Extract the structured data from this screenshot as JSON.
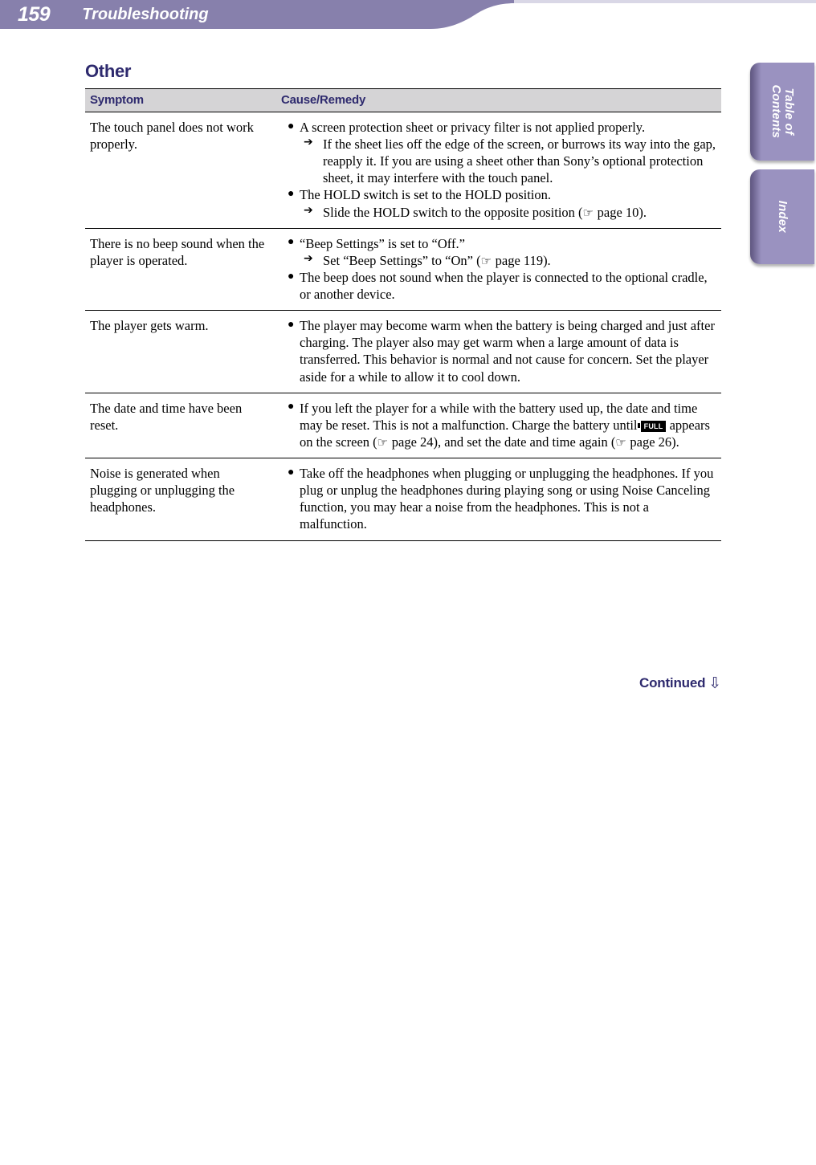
{
  "header": {
    "page_number": "159",
    "chapter_title": "Troubleshooting",
    "band_color": "#8780ac",
    "thin_rule_color": "#d9d7e6"
  },
  "side_tabs": [
    {
      "name": "table-of-contents",
      "line1": "Table of",
      "line2": "Contents"
    },
    {
      "name": "index",
      "line1": "Index",
      "line2": ""
    }
  ],
  "section": {
    "title": "Other",
    "title_color": "#2e2a6e"
  },
  "table": {
    "header_bg": "#d5d4d6",
    "columns": [
      "Symptom",
      "Cause/Remedy"
    ],
    "rows": [
      {
        "symptom": "The touch panel does not work properly.",
        "bullets": [
          {
            "text": "A screen protection sheet or privacy filter is not applied properly.",
            "arrows": [
              "If the sheet lies off the edge of the screen, or burrows its way into the gap, reapply it. If you are using a sheet other than Sony’s optional protection sheet, it may interfere with the touch panel."
            ]
          },
          {
            "text": "The HOLD switch is set to the HOLD position.",
            "arrows_rich": [
              {
                "pre": "Slide the HOLD switch to the opposite position (",
                "icon": "hand-pointing-icon",
                "mid": " page 10).",
                "post": ""
              }
            ]
          }
        ]
      },
      {
        "symptom": "There is no beep sound when the player is operated.",
        "bullets": [
          {
            "text": "“Beep Settings” is set to “Off.”",
            "arrows_rich": [
              {
                "pre": "Set “Beep Settings” to “On” (",
                "icon": "hand-pointing-icon",
                "mid": " page 119).",
                "post": ""
              }
            ]
          },
          {
            "text": "The beep does not sound when the player is connected to the optional cradle, or another device."
          }
        ]
      },
      {
        "symptom": "The player gets warm.",
        "bullets": [
          {
            "text": "The player may become warm when the battery is being charged and just after charging. The player also may get warm when a large amount of data is transferred. This behavior is normal and not cause for concern. Set the player aside for a while to allow it to cool down."
          }
        ]
      },
      {
        "symptom": "The date and time have been reset.",
        "bullets": [
          {
            "rich": {
              "p1": "If you left the player for a while with the battery used up, the date and time may be reset. This is not a malfunction. Charge the battery until ",
              "badge": "FULL",
              "p2": " appears on the screen (",
              "icon": "hand-pointing-icon",
              "p3": " page 24), and set the date and time again (",
              "icon2": "hand-pointing-icon",
              "p4": " page 26)."
            }
          }
        ]
      },
      {
        "symptom": "Noise is generated when plugging or unplugging the headphones.",
        "bullets": [
          {
            "text": "Take off the headphones when plugging or unplugging the headphones. If you plug or unplug the headphones during playing song or using Noise Canceling function, you may hear a noise from the headphones. This is not a malfunction."
          }
        ]
      }
    ]
  },
  "footer": {
    "continued_label": "Continued",
    "continued_arrow": "⇩"
  },
  "glyphs": {
    "bullet": "●",
    "arrow": "➔",
    "hand": "☞"
  }
}
